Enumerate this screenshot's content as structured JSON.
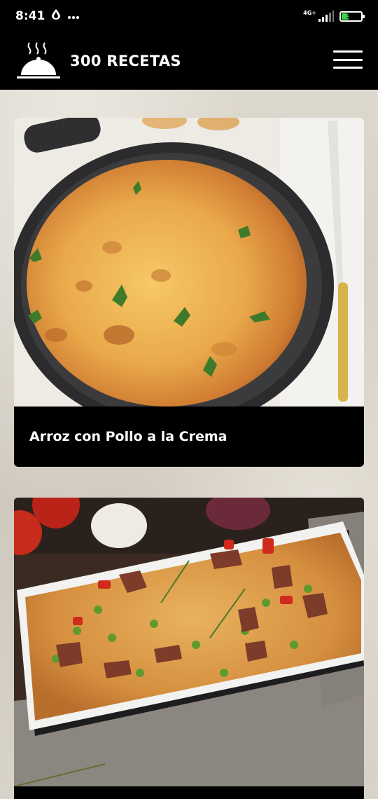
{
  "status_bar": {
    "time": "8:41",
    "network": "4G+",
    "battery": "37",
    "battery_level": 0.37,
    "icons": [
      "water-drop-icon",
      "more-dots-icon",
      "signal-icon",
      "battery-icon"
    ]
  },
  "app_bar": {
    "title": "300 RECETAS",
    "logo_icon": "serving-cloche-icon",
    "menu_icon": "hamburger-menu-icon"
  },
  "recipes": [
    {
      "title": "Arroz con Pollo a la Crema",
      "image": "baked-rice-skillet-photo"
    },
    {
      "title": "",
      "image": "rice-chicken-casserole-photo"
    }
  ],
  "colors": {
    "bar_background": "#000000",
    "text": "#ffffff",
    "battery_fill": "#3fd14a"
  }
}
